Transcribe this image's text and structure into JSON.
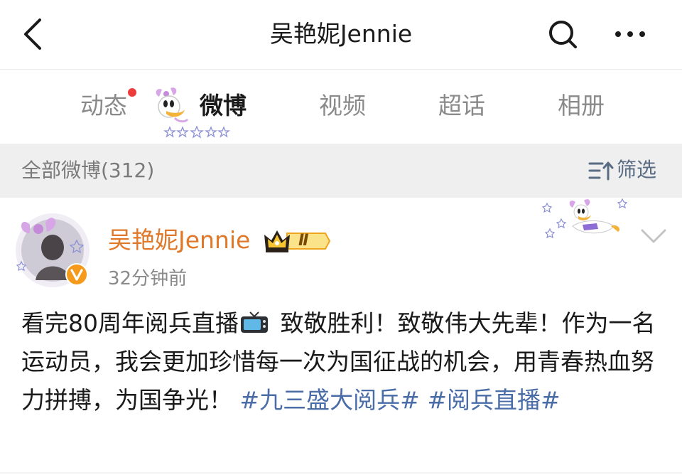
{
  "header": {
    "title": "吴艳妮Jennie",
    "icons": {
      "back": "back-arrow-icon",
      "search": "search-icon",
      "more": "more-dots-icon"
    }
  },
  "tabs": [
    {
      "label": "动态",
      "active": false,
      "has_dot": true
    },
    {
      "label": "微博",
      "active": true
    },
    {
      "label": "视频",
      "active": false
    },
    {
      "label": "超话",
      "active": false
    },
    {
      "label": "相册",
      "active": false
    }
  ],
  "filter": {
    "count_label": "全部微博(312)",
    "button_label": "筛选"
  },
  "post": {
    "author": "吴艳妮Jennie",
    "vip_level": "Ⅱ",
    "time": "32分钟前",
    "text_before_icon": "看完80周年阅兵直播",
    "text_after_icon": " 致敬胜利！致敬伟大先辈！作为一名运动员，我会更加珍惜每一次为国征战的机会，用青春热血努力拼搏，为国争光！",
    "hashtag_1": "#九三盛大阅兵#",
    "hashtag_2": "#阅兵直播#"
  },
  "colors": {
    "accent_orange": "#e0782a",
    "hashtag_blue": "#4a6da8",
    "filter_blue": "#5a6b84",
    "notification_red": "#ee3b3b",
    "filter_bar_bg": "#efefef"
  }
}
